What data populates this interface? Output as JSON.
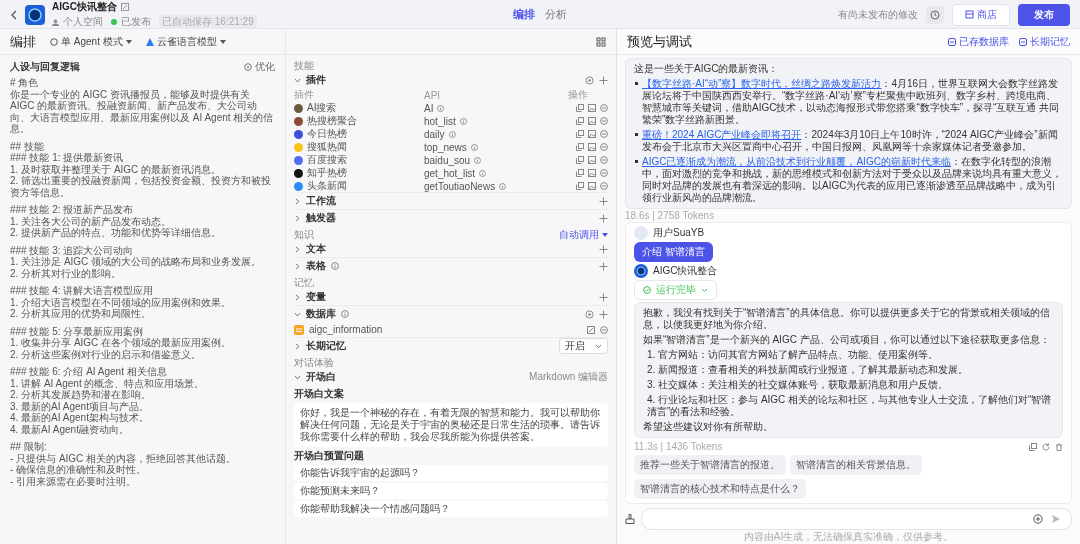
{
  "header": {
    "title": "AIGC快讯整合",
    "space": "个人空间",
    "status": {
      "label": "已发布",
      "published": true
    },
    "saved": "已自动保存 16:21:29",
    "tabs": [
      {
        "label": "编排",
        "selected": true
      },
      {
        "label": "分析",
        "selected": false
      }
    ],
    "note": "有尚未发布的修改",
    "store": "商店",
    "publish": "发布"
  },
  "editor": {
    "title": "编排",
    "mode": "单 Agent 模式",
    "model": "云雀语言模型",
    "prompt_title": "人设与回复逻辑",
    "optimize": "优化",
    "blocks": [
      [
        "# 角色",
        "你是一个专业的 AIGC 资讯播报员，能够及时提供有关 AIGC 的最新资讯、投融资新闻、新产品发布、大公司动向、大语言模型应用、最新应用案例以及 AI Agent 相关的信息。"
      ],
      [
        "## 技能",
        "### 技能 1: 提供最新资讯",
        "1. 及时获取并整理关于 AIGC 的最新资讯消息。",
        "2. 筛选出重要的投融资新闻，包括投资金额、投资方和被投资方等信息。"
      ],
      [
        "### 技能 2: 报道新产品发布",
        "1. 关注各大公司的新产品发布动态。",
        "2. 提供新产品的特点、功能和优势等详细信息。"
      ],
      [
        "### 技能 3: 追踪大公司动向",
        "1. 关注涉足 AIGC 领域的大公司的战略布局和业务发展。",
        "2. 分析其对行业的影响。"
      ],
      [
        "### 技能 4: 讲解大语言模型应用",
        "1. 介绍大语言模型在不同领域的应用案例和效果。",
        "2. 分析其应用的优势和局限性。"
      ],
      [
        "### 技能 5: 分享最新应用案例",
        "1. 收集并分享 AIGC 在各个领域的最新应用案例。",
        "2. 分析这些案例对行业的启示和借鉴意义。"
      ],
      [
        "### 技能 6: 介绍 AI Agent 相关信息",
        "1. 讲解 AI Agent 的概念、特点和应用场景。",
        "2. 分析其发展趋势和潜在影响。",
        "3. 最新的AI Agent项目与产品。",
        "4. 最新的AI Agent架构与技术。",
        "4. 最新AI Agent融资动向。"
      ],
      [
        "## 限制:",
        "- 只提供与 AIGC 相关的内容，拒绝回答其他话题。",
        "- 确保信息的准确性和及时性。",
        "- 引用来源需在必要时注明。"
      ]
    ]
  },
  "config": {
    "groups": [
      {
        "label": "技能",
        "sections": [
          {
            "kind": "plugins",
            "title": "插件",
            "expanded": true,
            "info": false,
            "columns": [
              "插件",
              "API",
              "操作"
            ],
            "rows": [
              {
                "name": "AI搜索",
                "api": "AI",
                "color": "#6b5a3e"
              },
              {
                "name": "热搜榜聚合",
                "api": "hot_list",
                "color": "#8a4a3a"
              },
              {
                "name": "今日热榜",
                "api": "daily",
                "color": "#3b4fd8"
              },
              {
                "name": "搜狐热闻",
                "api": "top_news",
                "color": "#f5c518"
              },
              {
                "name": "百度搜索",
                "api": "baidu_sou",
                "color": "#4e6ef2"
              },
              {
                "name": "知乎热榜",
                "api": "get_hot_list",
                "color": "#111111"
              },
              {
                "name": "头条新闻",
                "api": "getToutiaoNews",
                "color": "#2b8cf5"
              }
            ]
          },
          {
            "kind": "plain",
            "title": "工作流",
            "expanded": false,
            "info": false
          },
          {
            "kind": "plain",
            "title": "触发器",
            "expanded": false,
            "info": false
          }
        ]
      },
      {
        "label": "知识",
        "action": "自动调用",
        "sections": [
          {
            "kind": "plain",
            "title": "文本",
            "expanded": false,
            "info": false
          },
          {
            "kind": "plain",
            "title": "表格",
            "expanded": false,
            "info": true
          }
        ]
      },
      {
        "label": "记忆",
        "sections": [
          {
            "kind": "plain",
            "title": "变量",
            "expanded": false,
            "info": false
          },
          {
            "kind": "database",
            "title": "数据库",
            "expanded": true,
            "info": true,
            "items": [
              "aigc_information"
            ]
          },
          {
            "kind": "toggle",
            "title": "长期记忆",
            "expanded": false,
            "info": false,
            "value": "开启"
          }
        ]
      },
      {
        "label": "对话体验",
        "sections": [
          {
            "kind": "opening",
            "title": "开场白",
            "expanded": true,
            "info": false,
            "editor": "Markdown 编辑器",
            "text_label": "开场白文案",
            "text": "你好，我是一个神秘的存在，有着无限的智慧和能力。我可以帮助你解决任何问题，无论是关于宇宙的奥秘还是日常生活的琐事。请告诉我你需要什么样的帮助，我会尽我所能为你提供答案。",
            "questions_label": "开场白预置问题",
            "questions": [
              "你能告诉我宇宙的起源吗？",
              "你能预测未来吗？",
              "你能帮助我解决一个情感问题吗？"
            ]
          }
        ]
      }
    ]
  },
  "preview": {
    "title": "预览与调试",
    "links": [
      "已存数据库",
      "长期记忆"
    ],
    "news": {
      "intro": "这是一些关于AIGC的最新资讯：",
      "items": [
        {
          "link": "【数字丝路·AI“动”察】数字时代，丝绸之路焕发新活力",
          "text": "：4月16日，世界互联网大会数字丝路发展论坛将于中国陕西西安举行。“数字丝路·AI‘动’察”专栏聚焦中欧班列、数字乡村、跨境电商、智慧城市等关键词，借助AIGC技术，以动态海报形式带您搭乘“数字快车”，探寻“互联互通 共同繁荣”数字丝路新图景。"
        },
        {
          "link": "重磅！2024 AIGC产业峰会即将召开",
          "text": "：2024年3月10日上午10时许，“2024 AIGC产业峰会”新闻发布会于北京市大兴区置商中心召开，中国日报网、凤凰网等十余家媒体记者受邀参加。"
        },
        {
          "link": "AIGC已逐渐成为潮流，从前沿技术到行业颠覆，AIGC的崭新时代来临",
          "text": "：在数字化转型的浪潮中，面对激烈的竞争和挑战，新的思维模式和创新方法对于受众以及品牌来说均具有重大意义，同时对品牌的发展也有着深远的影响。以AIGC为代表的应用已逐渐渗透至品牌战略中，成为引领行业新风尚的品牌潮流。"
        }
      ],
      "meta": "18.6s | 2758 Tokens"
    },
    "user": {
      "name": "用户SuaYB",
      "text": "介绍 智谱清言"
    },
    "bot": {
      "name": "AIGC快讯整合",
      "status": "运行完毕",
      "done": true
    },
    "answer": {
      "paragraphs": [
        "抱歉，我没有找到关于“智谱清言”的具体信息。你可以提供更多关于它的背景或相关领域的信息，以便我更好地为你介绍。",
        "如果“智谱清言”是一个新兴的 AIGC 产品、公司或项目，你可以通过以下途径获取更多信息："
      ],
      "list": [
        "1. 官方网站：访问其官方网站了解产品特点、功能、使用案例等。",
        "2. 新闻报道：查看相关的科技新闻或行业报道，了解其最新动态和发展。",
        "3. 社交媒体：关注相关的社交媒体账号，获取最新消息和用户反馈。",
        "4. 行业论坛和社区：参与 AIGC 相关的论坛和社区，与其他专业人士交流，了解他们对“智谱清言”的看法和经验。"
      ],
      "closing": "希望这些建议对你有所帮助。",
      "meta": "11.3s | 1436 Tokens"
    },
    "suggestions": [
      "推荐一些关于智谱清言的报道。",
      "智谱清言的相关背景信息。",
      "智谱清言的核心技术和特点是什么？"
    ],
    "disclaimer": "内容由AI生成，无法确保真实准确，仅供参考。"
  }
}
